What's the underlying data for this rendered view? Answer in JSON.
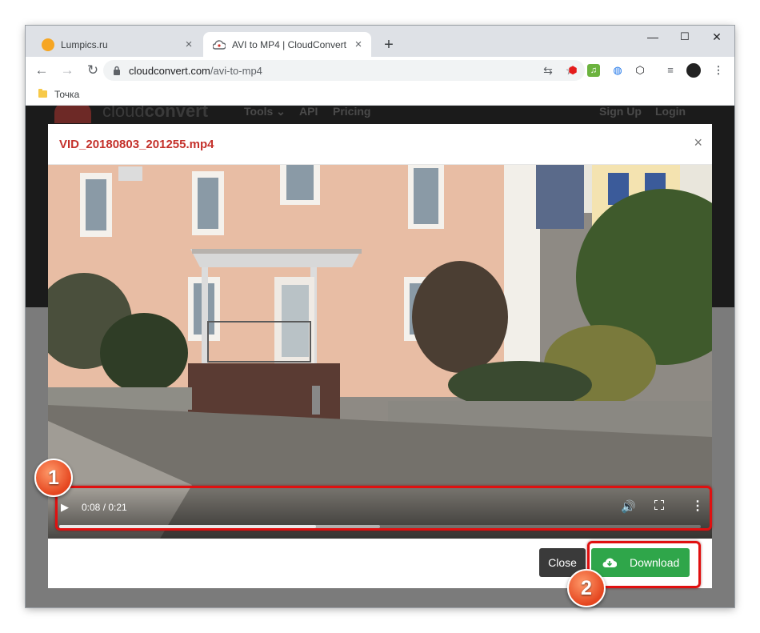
{
  "browser": {
    "tabs": [
      {
        "title": "Lumpics.ru",
        "active": false
      },
      {
        "title": "AVI to MP4 | CloudConvert",
        "active": true
      }
    ],
    "new_tab": "+",
    "window_controls": {
      "minimize": "—",
      "maximize": "☐",
      "close": "✕"
    },
    "url": {
      "host": "cloudconvert.com",
      "path": "/avi-to-mp4"
    },
    "bookmarks": [
      {
        "label": "Точка"
      }
    ]
  },
  "site": {
    "logo_light": "cloud",
    "logo_bold": "convert",
    "nav": {
      "tools": "Tools ⌄",
      "api": "API",
      "pricing": "Pricing",
      "signup": "Sign Up",
      "login": "Login"
    }
  },
  "modal": {
    "title": "VID_20180803_201255.mp4",
    "close_icon": "×",
    "video": {
      "time": "0:08 / 0:21",
      "progress_fraction": 0.4,
      "buffered_fraction": 0.5
    },
    "buttons": {
      "close": "Close",
      "download": "Download"
    }
  },
  "annotations": {
    "badge_1": "1",
    "badge_2": "2",
    "highlight_color": "#e01010"
  },
  "colors": {
    "accent_red": "#c4312b",
    "download_green": "#2fa64a",
    "close_dark": "#3a3a3a"
  }
}
